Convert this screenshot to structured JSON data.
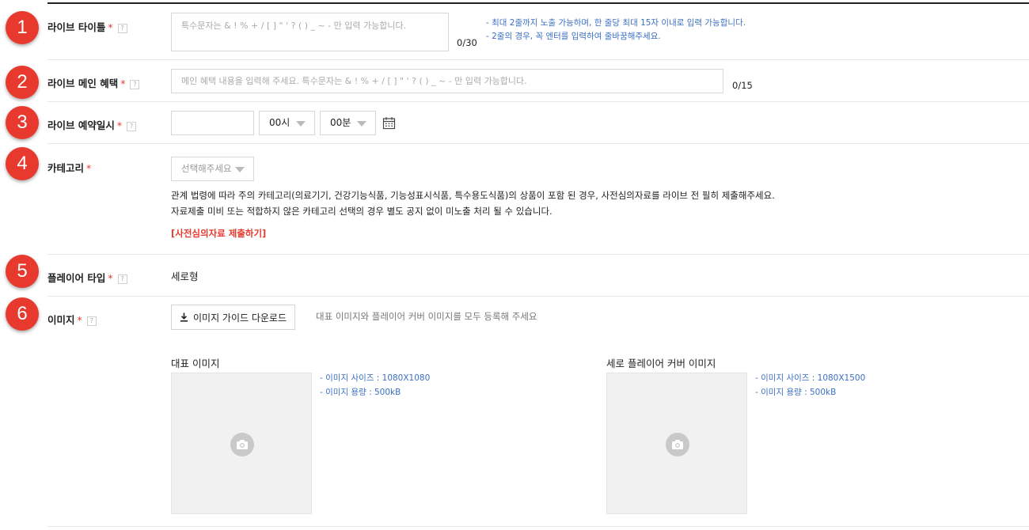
{
  "steps": [
    "1",
    "2",
    "3",
    "4",
    "5",
    "6"
  ],
  "required_mark": "*",
  "help_mark": "?",
  "live_title": {
    "label": "라이브 타이틀",
    "placeholder": "특수문자는 & ! % + / [ ] \" ' ? ( ) _ ~ - 만 입력 가능합니다.",
    "counter": "0/30",
    "hints": [
      "- 최대 2줄까지 노출 가능하며, 한 줄당 최대 15자 이내로 입력 가능합니다.",
      "- 2줄의 경우, 꼭 엔터를 입력하여 줄바꿈해주세요."
    ]
  },
  "main_benefit": {
    "label": "라이브 메인 혜택",
    "placeholder": "메인 혜택 내용을 입력해 주세요. 특수문자는 & ! % + / [ ] \" ' ? ( ) _ ~ - 만 입력 가능합니다.",
    "counter": "0/15"
  },
  "schedule": {
    "label": "라이브 예약일시",
    "date_value": "",
    "hour": "00시",
    "minute": "00분"
  },
  "category": {
    "label": "카테고리",
    "select_placeholder": "선택해주세요",
    "notice_lines": [
      "관계 법령에 따라 주의 카테고리(의료기기, 건강기능식품, 기능성표시식품, 특수용도식품)의 상품이 포함 된 경우, 사전심의자료를 라이브 전 필히 제출해주세요.",
      "자료제출 미비 또는 적합하지 않은 카테고리 선택의 경우 별도 공지 없이 미노출 처리 될 수 있습니다."
    ],
    "submit_link": "[사전심의자료 제출하기]"
  },
  "player_type": {
    "label": "플레이어 타입",
    "value": "세로형"
  },
  "images": {
    "label": "이미지",
    "download_button": "이미지 가이드 다운로드",
    "note": "대표 이미지와 플레이어 커버 이미지를 모두 등록해 주세요",
    "main_image": {
      "title": "대표 이미지",
      "hints": [
        "- 이미지 사이즈 : 1080X1080",
        "- 이미지 용량 : 500kB"
      ]
    },
    "cover_image": {
      "title": "세로 플레이어 커버 이미지",
      "hints": [
        "- 이미지 사이즈 : 1080X1500",
        "- 이미지 용량 : 500kB"
      ]
    }
  },
  "colors": {
    "accent_red": "#e8392e",
    "hint_blue": "#3b6fc4",
    "border": "#d7d7d7"
  }
}
